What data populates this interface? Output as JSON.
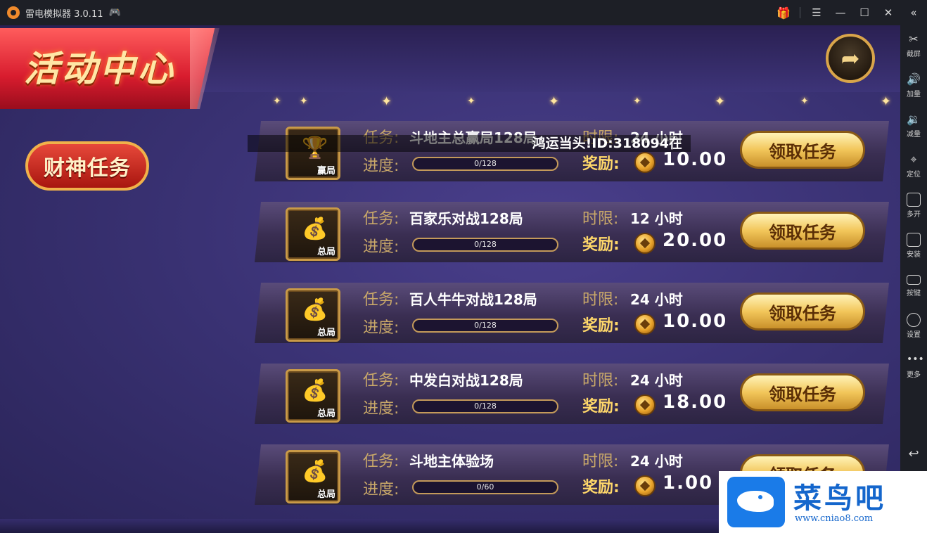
{
  "window": {
    "title": "雷电模拟器 3.0.11",
    "icons": [
      "app-logo-icon",
      "gamepad-icon",
      "gift-icon",
      "menu-icon",
      "minimize-icon",
      "maximize-icon",
      "close-icon",
      "collapse-icon"
    ]
  },
  "sidebar": {
    "items": [
      {
        "label": "截屏",
        "icon": "scissors-icon"
      },
      {
        "label": "加量",
        "icon": "volume-up-icon"
      },
      {
        "label": "减量",
        "icon": "volume-down-icon"
      },
      {
        "label": "定位",
        "icon": "location-icon"
      },
      {
        "label": "多开",
        "icon": "multi-instance-icon"
      },
      {
        "label": "安装",
        "icon": "apk-install-icon"
      },
      {
        "label": "按键",
        "icon": "keyboard-icon"
      },
      {
        "label": "设置",
        "icon": "settings-icon"
      },
      {
        "label": "更多",
        "icon": "more-icon"
      }
    ],
    "back_icon": "back-icon"
  },
  "game": {
    "title": "活动中心",
    "side_tab": "财神任务",
    "banner": "鸿运当头!ID:318094在",
    "labels": {
      "task": "任务:",
      "progress": "进度:",
      "time_limit": "时限:",
      "reward": "奖励:",
      "claim": "领取任务"
    },
    "tasks": [
      {
        "name": "斗地主总赢局128局",
        "badge": "赢局",
        "progress_text": "0/128",
        "progress": 0,
        "time_limit": "24 小时",
        "reward": "10.00"
      },
      {
        "name": "百家乐对战128局",
        "badge": "总局",
        "progress_text": "0/128",
        "progress": 0,
        "time_limit": "12 小时",
        "reward": "20.00"
      },
      {
        "name": "百人牛牛对战128局",
        "badge": "总局",
        "progress_text": "0/128",
        "progress": 0,
        "time_limit": "24 小时",
        "reward": "10.00"
      },
      {
        "name": "中发白对战128局",
        "badge": "总局",
        "progress_text": "0/128",
        "progress": 0,
        "time_limit": "24 小时",
        "reward": "18.00"
      },
      {
        "name": "斗地主体验场",
        "badge": "总局",
        "progress_text": "0/60",
        "progress": 0,
        "time_limit": "24 小时",
        "reward": "1.00"
      }
    ]
  },
  "watermark": {
    "title": "菜鸟吧",
    "url": "www.cniao8.com"
  }
}
